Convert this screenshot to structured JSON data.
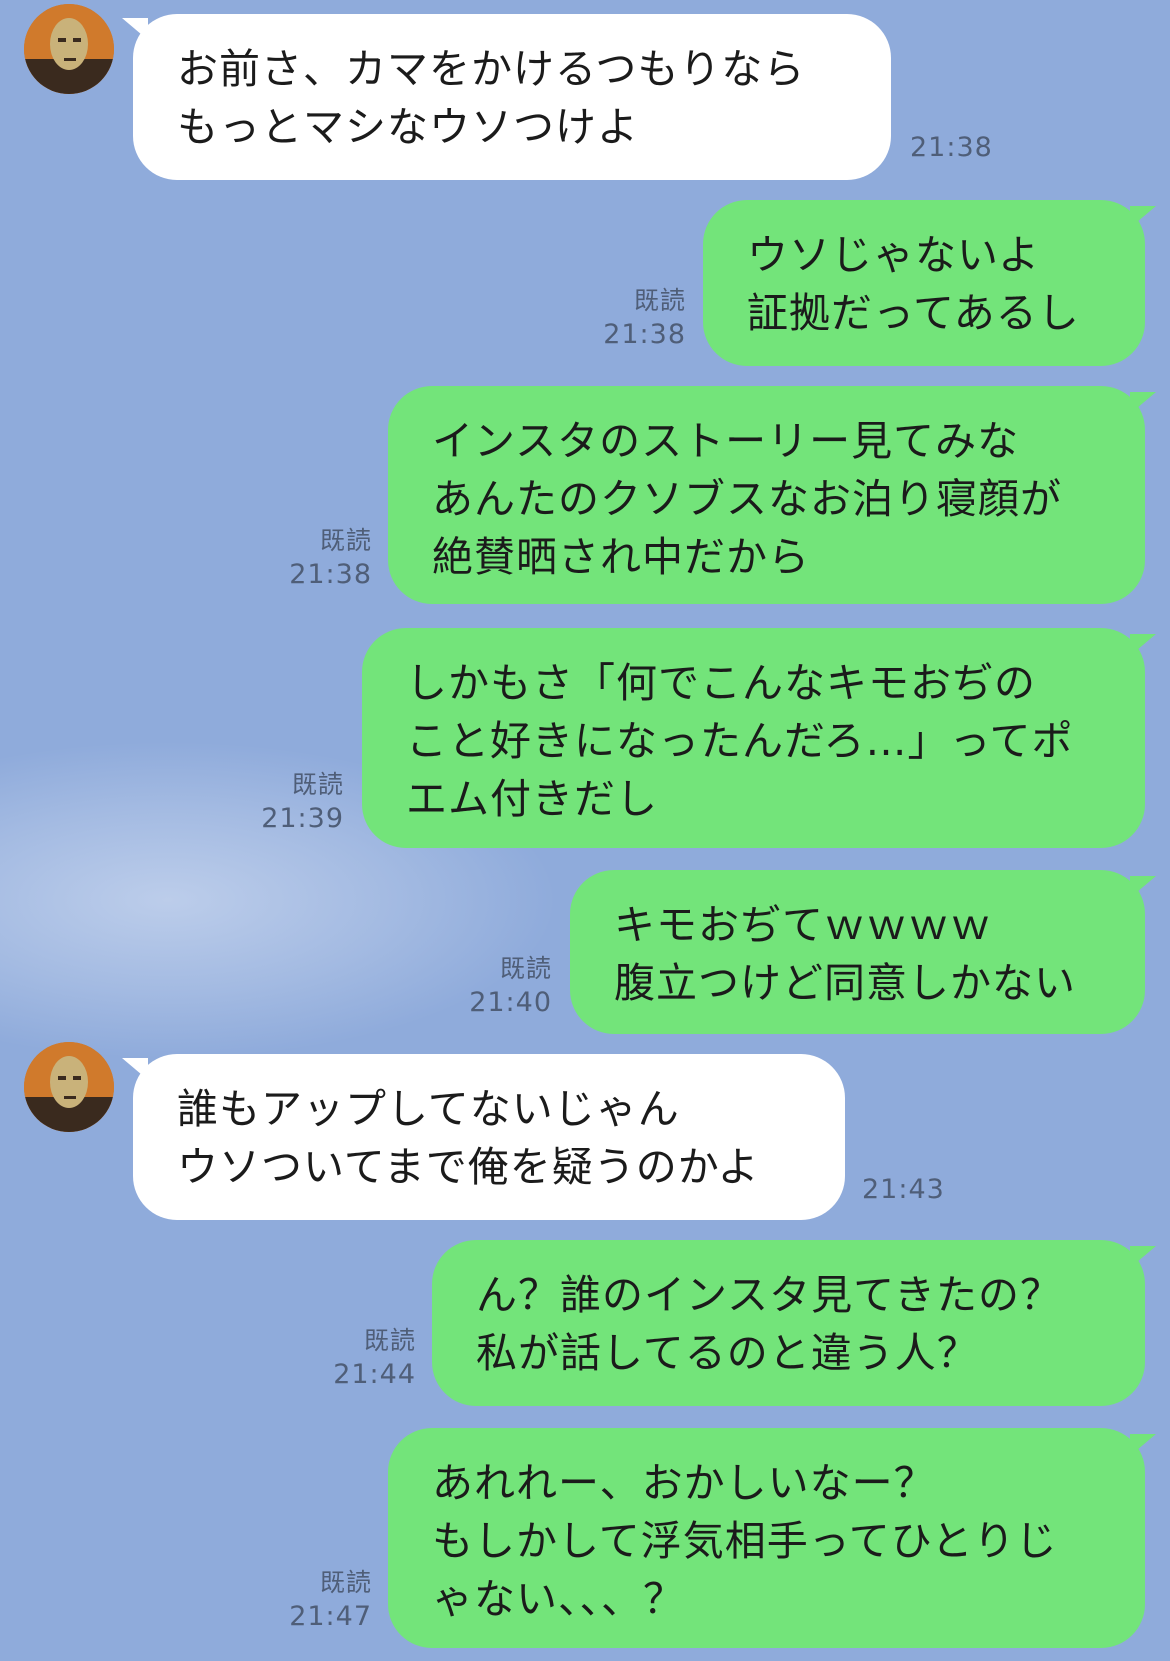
{
  "read_label": "既読",
  "colors": {
    "background": "#8fabdb",
    "incoming_bubble": "#ffffff",
    "outgoing_bubble": "#73e47a",
    "meta_text": "#4f5e78"
  },
  "messages": [
    {
      "side": "in",
      "text": "お前さ、カマをかけるつもりなら\nもっとマシなウソつけよ",
      "time": "21:38"
    },
    {
      "side": "out",
      "text": "ウソじゃないよ\n証拠だってあるし",
      "time": "21:38"
    },
    {
      "side": "out",
      "text": "インスタのストーリー見てみな\nあんたのクソブスなお泊り寝顔が\n絶賛晒され中だから",
      "time": "21:38"
    },
    {
      "side": "out",
      "text": "しかもさ「何でこんなキモおぢの\nこと好きになったんだろ…」ってポ\nエム付きだし",
      "time": "21:39"
    },
    {
      "side": "out",
      "text": "キモおぢてｗｗｗｗ\n腹立つけど同意しかない",
      "time": "21:40"
    },
    {
      "side": "in",
      "text": "誰もアップしてないじゃん\nウソついてまで俺を疑うのかよ",
      "time": "21:43"
    },
    {
      "side": "out",
      "text": "ん？誰のインスタ見てきたの？\n私が話してるのと違う人？",
      "time": "21:44"
    },
    {
      "side": "out",
      "text": "あれれー、おかしいなー？\nもしかして浮気相手ってひとりじ\nゃない、、、？",
      "time": "21:47"
    }
  ]
}
